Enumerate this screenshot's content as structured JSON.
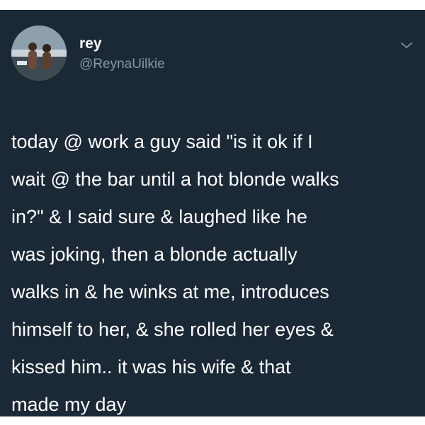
{
  "colors": {
    "background": "#1b2836",
    "text": "#ffffff",
    "muted": "#8899a6"
  },
  "user": {
    "display_name": "rey",
    "handle": "@ReynaUilkie",
    "avatar": "profile-photo"
  },
  "menu": {
    "icon": "chevron-down-icon"
  },
  "tweet": {
    "lines": [
      "today @ work a guy said \"is it ok if I",
      "wait @ the bar until a hot blonde walks",
      "in?\" & I said sure & laughed like he",
      "was joking, then a blonde actually",
      "walks in & he winks at me, introduces",
      "himself to her, & she rolled her eyes &",
      "kissed him.. it was his wife & that",
      "made my day"
    ]
  }
}
